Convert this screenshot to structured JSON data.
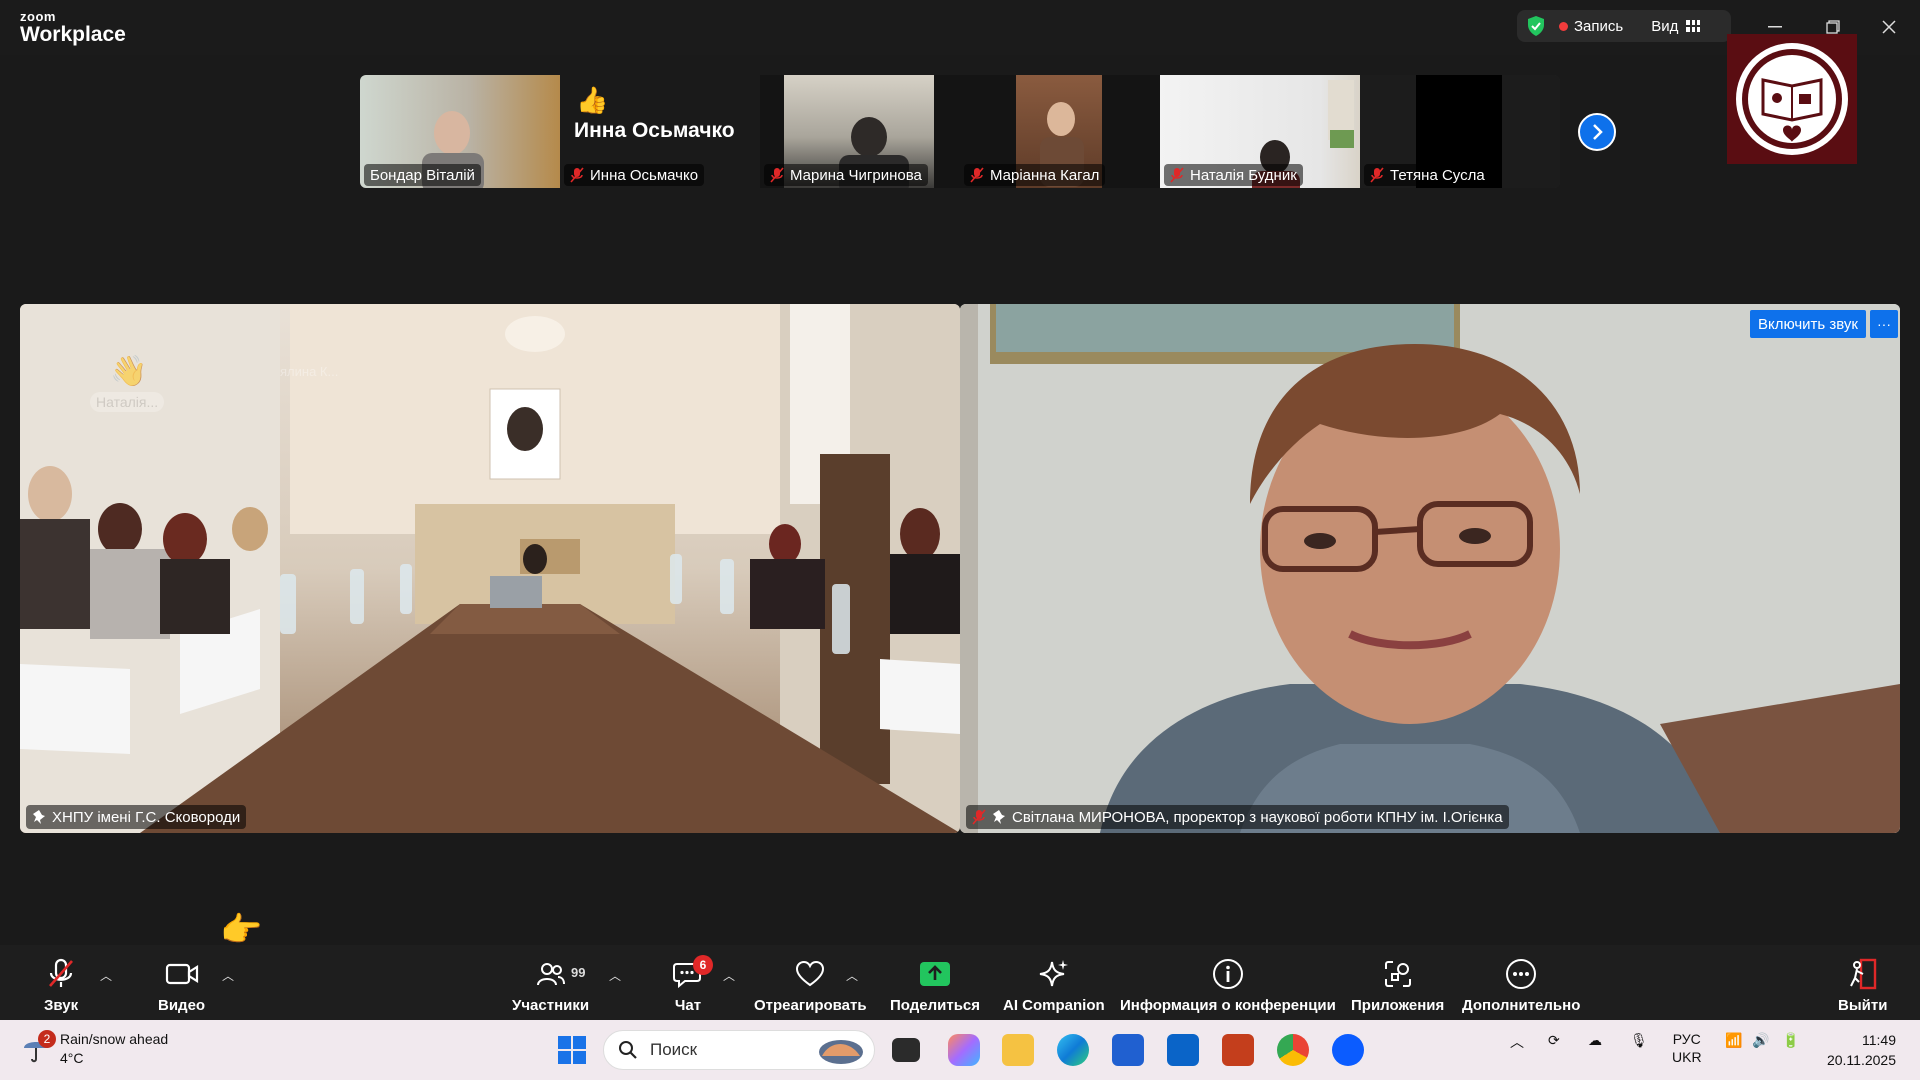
{
  "app": {
    "brand_small": "zoom",
    "brand_big": "Workplace"
  },
  "titlebar": {
    "record_label": "Запись",
    "view_label": "Вид"
  },
  "filmstrip": [
    {
      "name": "Бондар Віталій",
      "muted": false
    },
    {
      "name": "Инна Осьмачко",
      "muted": true,
      "avatar_text": "Инна Осьмачко",
      "reaction": "👍"
    },
    {
      "name": "Марина Чигринова",
      "muted": true
    },
    {
      "name": "Маріанна Кагал",
      "muted": true
    },
    {
      "name": "Наталія Будник",
      "muted": true
    },
    {
      "name": "Тетяна Сусла",
      "muted": true
    }
  ],
  "main": {
    "left": {
      "label": "ХНПУ імені Г.С. Сковороди",
      "overlay_name": "Наталія...",
      "overlay_name2": "ялина К..."
    },
    "right": {
      "label": "Світлана МИРОНОВА, проректор з наукової роботи КПНУ ім. І.Огієнка",
      "unmute_label": "Включить звук",
      "more_label": "···"
    }
  },
  "toolbar": {
    "audio": "Звук",
    "video": "Видео",
    "participants": "Участники",
    "participants_count": "99",
    "chat": "Чат",
    "chat_badge": "6",
    "react": "Отреагировать",
    "share": "Поделиться",
    "ai": "AI Companion",
    "info": "Информация о конференции",
    "apps": "Приложения",
    "more": "Дополнительно",
    "leave": "Выйти"
  },
  "taskbar": {
    "weather_title": "Rain/snow ahead",
    "weather_temp": "4°C",
    "weather_badge": "2",
    "search_placeholder": "Поиск",
    "lang_top": "РУС",
    "lang_bottom": "UKR",
    "time": "11:49",
    "date": "20.11.2025"
  },
  "colors": {
    "accent": "#0e71eb",
    "share_green": "#22c55e",
    "danger": "#e02828",
    "toolbar_bg": "#1e1e1e"
  }
}
